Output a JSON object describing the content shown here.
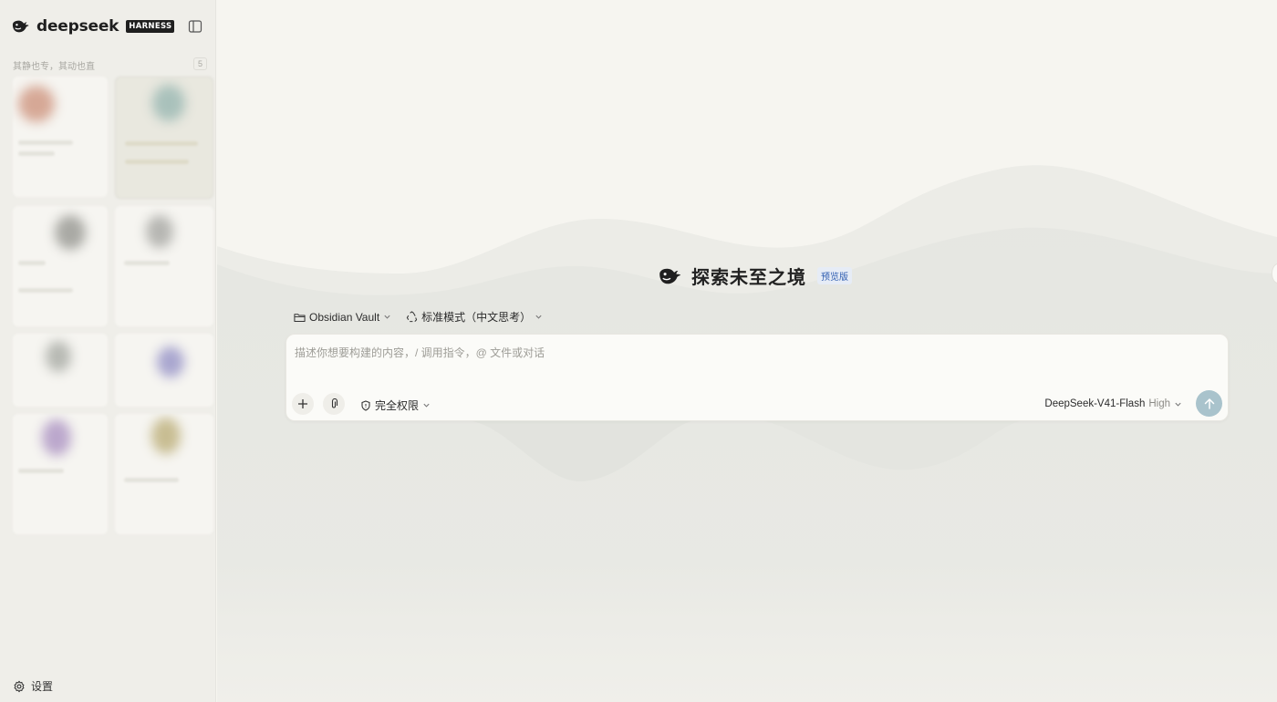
{
  "sidebar": {
    "brand_name": "deepseek",
    "brand_badge": "HARNESS",
    "section_label": "其静也专，其动也直",
    "section_count": "5",
    "settings_label": "设置"
  },
  "hero": {
    "title": "探索未至之境",
    "badge": "预览版"
  },
  "context": {
    "vault_label": "Obsidian Vault",
    "mode_label": "标准模式（中文思考）"
  },
  "composer": {
    "placeholder": "描述你想要构建的内容，/ 调用指令，@ 文件或对话",
    "value": "",
    "permission_label": "完全权限",
    "model_name": "DeepSeek-V41-Flash",
    "model_level": "High"
  },
  "colors": {
    "send_button": "#a9c3cc",
    "hero_badge_text": "#2f5db0",
    "background": "#f6f5f0"
  },
  "icons": [
    "whale-logo-icon",
    "sidebar-toggle-icon",
    "gear-icon",
    "folder-icon",
    "recycle-icon",
    "chevron-down-icon",
    "plus-icon",
    "paperclip-icon",
    "shield-icon",
    "arrow-up-icon"
  ]
}
